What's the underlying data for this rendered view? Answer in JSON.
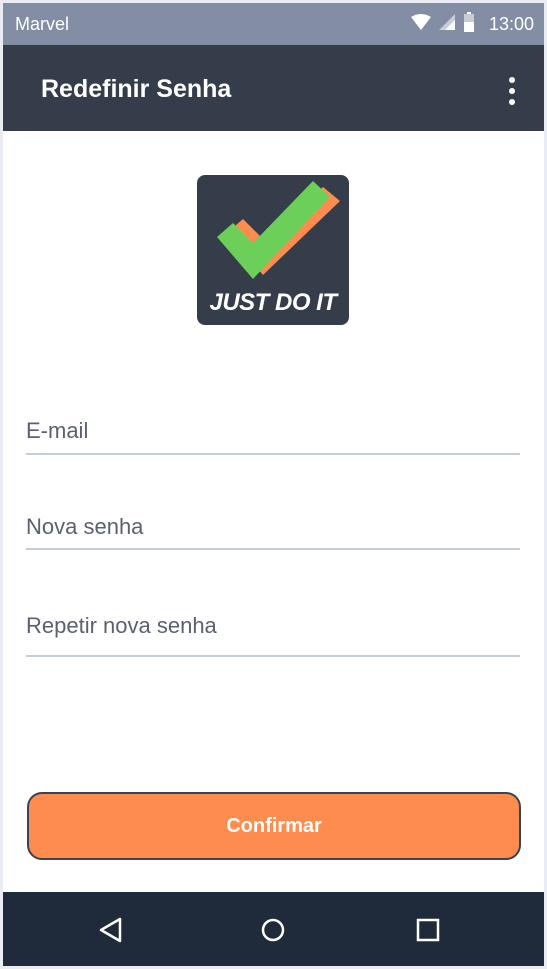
{
  "status_bar": {
    "carrier": "Marvel",
    "time": "13:00",
    "icons": [
      "wifi-icon",
      "signal-icon",
      "battery-icon"
    ]
  },
  "app_bar": {
    "title": "Redefinir Senha",
    "menu_icon": "overflow-menu-icon"
  },
  "logo": {
    "text": "JUST DO IT",
    "icon": "checkmark-icon",
    "colors": {
      "background": "#353d4b",
      "check_front": "#6ccf5a",
      "check_back": "#ff8c4f"
    }
  },
  "form": {
    "email": {
      "placeholder": "E-mail",
      "value": ""
    },
    "new_password": {
      "placeholder": "Nova senha",
      "value": ""
    },
    "repeat_password": {
      "placeholder": "Repetir nova senha",
      "value": ""
    }
  },
  "confirm_button": {
    "label": "Confirmar"
  },
  "nav_bar": {
    "items": [
      "back-icon",
      "home-icon",
      "recent-apps-icon"
    ]
  },
  "colors": {
    "primary_dark": "#353d4b",
    "status_bar": "#838ea5",
    "accent": "#ff8c4f",
    "nav_bar": "#1f2b3a"
  }
}
